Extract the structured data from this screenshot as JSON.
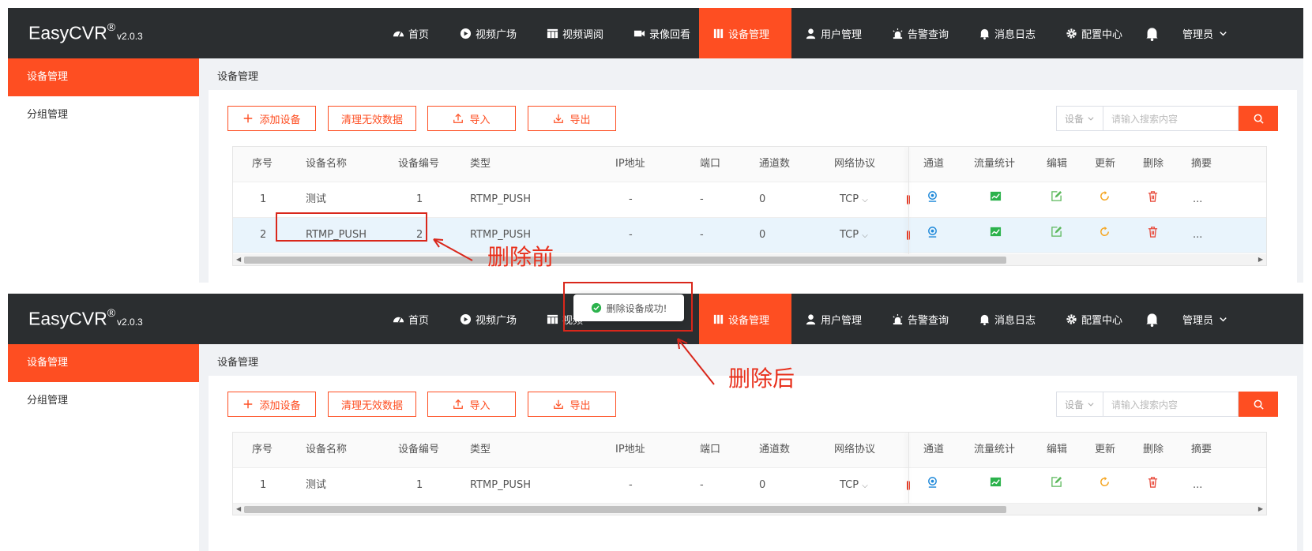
{
  "app": {
    "name": "EasyCVR",
    "reg": "®",
    "version": "v2.0.3"
  },
  "nav": [
    {
      "label": "首页",
      "icon": "dashboard-icon"
    },
    {
      "label": "视频广场",
      "icon": "play-circle-icon"
    },
    {
      "label": "视频调阅",
      "icon": "grid-view-icon"
    },
    {
      "label": "录像回看",
      "icon": "video-camera-icon"
    },
    {
      "label": "设备管理",
      "icon": "device-icon",
      "active": true
    },
    {
      "label": "用户管理",
      "icon": "user-icon"
    },
    {
      "label": "告警查询",
      "icon": "alarm-icon"
    },
    {
      "label": "消息日志",
      "icon": "bell-icon"
    },
    {
      "label": "配置中心",
      "icon": "gear-icon"
    }
  ],
  "nav_cut_label": "视频",
  "user_menu": "管理员",
  "sidebar": [
    {
      "label": "设备管理",
      "active": true
    },
    {
      "label": "分组管理"
    }
  ],
  "breadcrumb": "设备管理",
  "toolbar": {
    "add": "添加设备",
    "clean": "清理无效数据",
    "import": "导入",
    "export": "导出"
  },
  "search": {
    "select": "设备",
    "placeholder": "请输入搜索内容"
  },
  "columns": [
    "序号",
    "设备名称",
    "设备编号",
    "类型",
    "IP地址",
    "端口",
    "通道数",
    "网络协议",
    "通道",
    "流量统计",
    "编辑",
    "更新",
    "删除",
    "摘要"
  ],
  "rows_before": [
    {
      "no": "1",
      "name": "测试",
      "id": "1",
      "type": "RTMP_PUSH",
      "ip": "-",
      "port": "-",
      "channels": "0",
      "proto": "TCP",
      "more": "..."
    },
    {
      "no": "2",
      "name": "RTMP_PUSH",
      "id": "2",
      "type": "RTMP_PUSH",
      "ip": "-",
      "port": "-",
      "channels": "0",
      "proto": "TCP",
      "more": "..."
    }
  ],
  "rows_after": [
    {
      "no": "1",
      "name": "测试",
      "id": "1",
      "type": "RTMP_PUSH",
      "ip": "-",
      "port": "-",
      "channels": "0",
      "proto": "TCP",
      "more": "..."
    }
  ],
  "annotations": {
    "before": "删除前",
    "after": "删除后"
  },
  "toast": "删除设备成功!",
  "colors": {
    "accent": "#fe4e22",
    "topbar": "#2b2e30",
    "annotation": "#e8301c",
    "channel": "#1e88d9",
    "stats": "#2bb24c",
    "edit": "#5cb85c",
    "update": "#f5a623",
    "delete": "#e84a3b"
  }
}
